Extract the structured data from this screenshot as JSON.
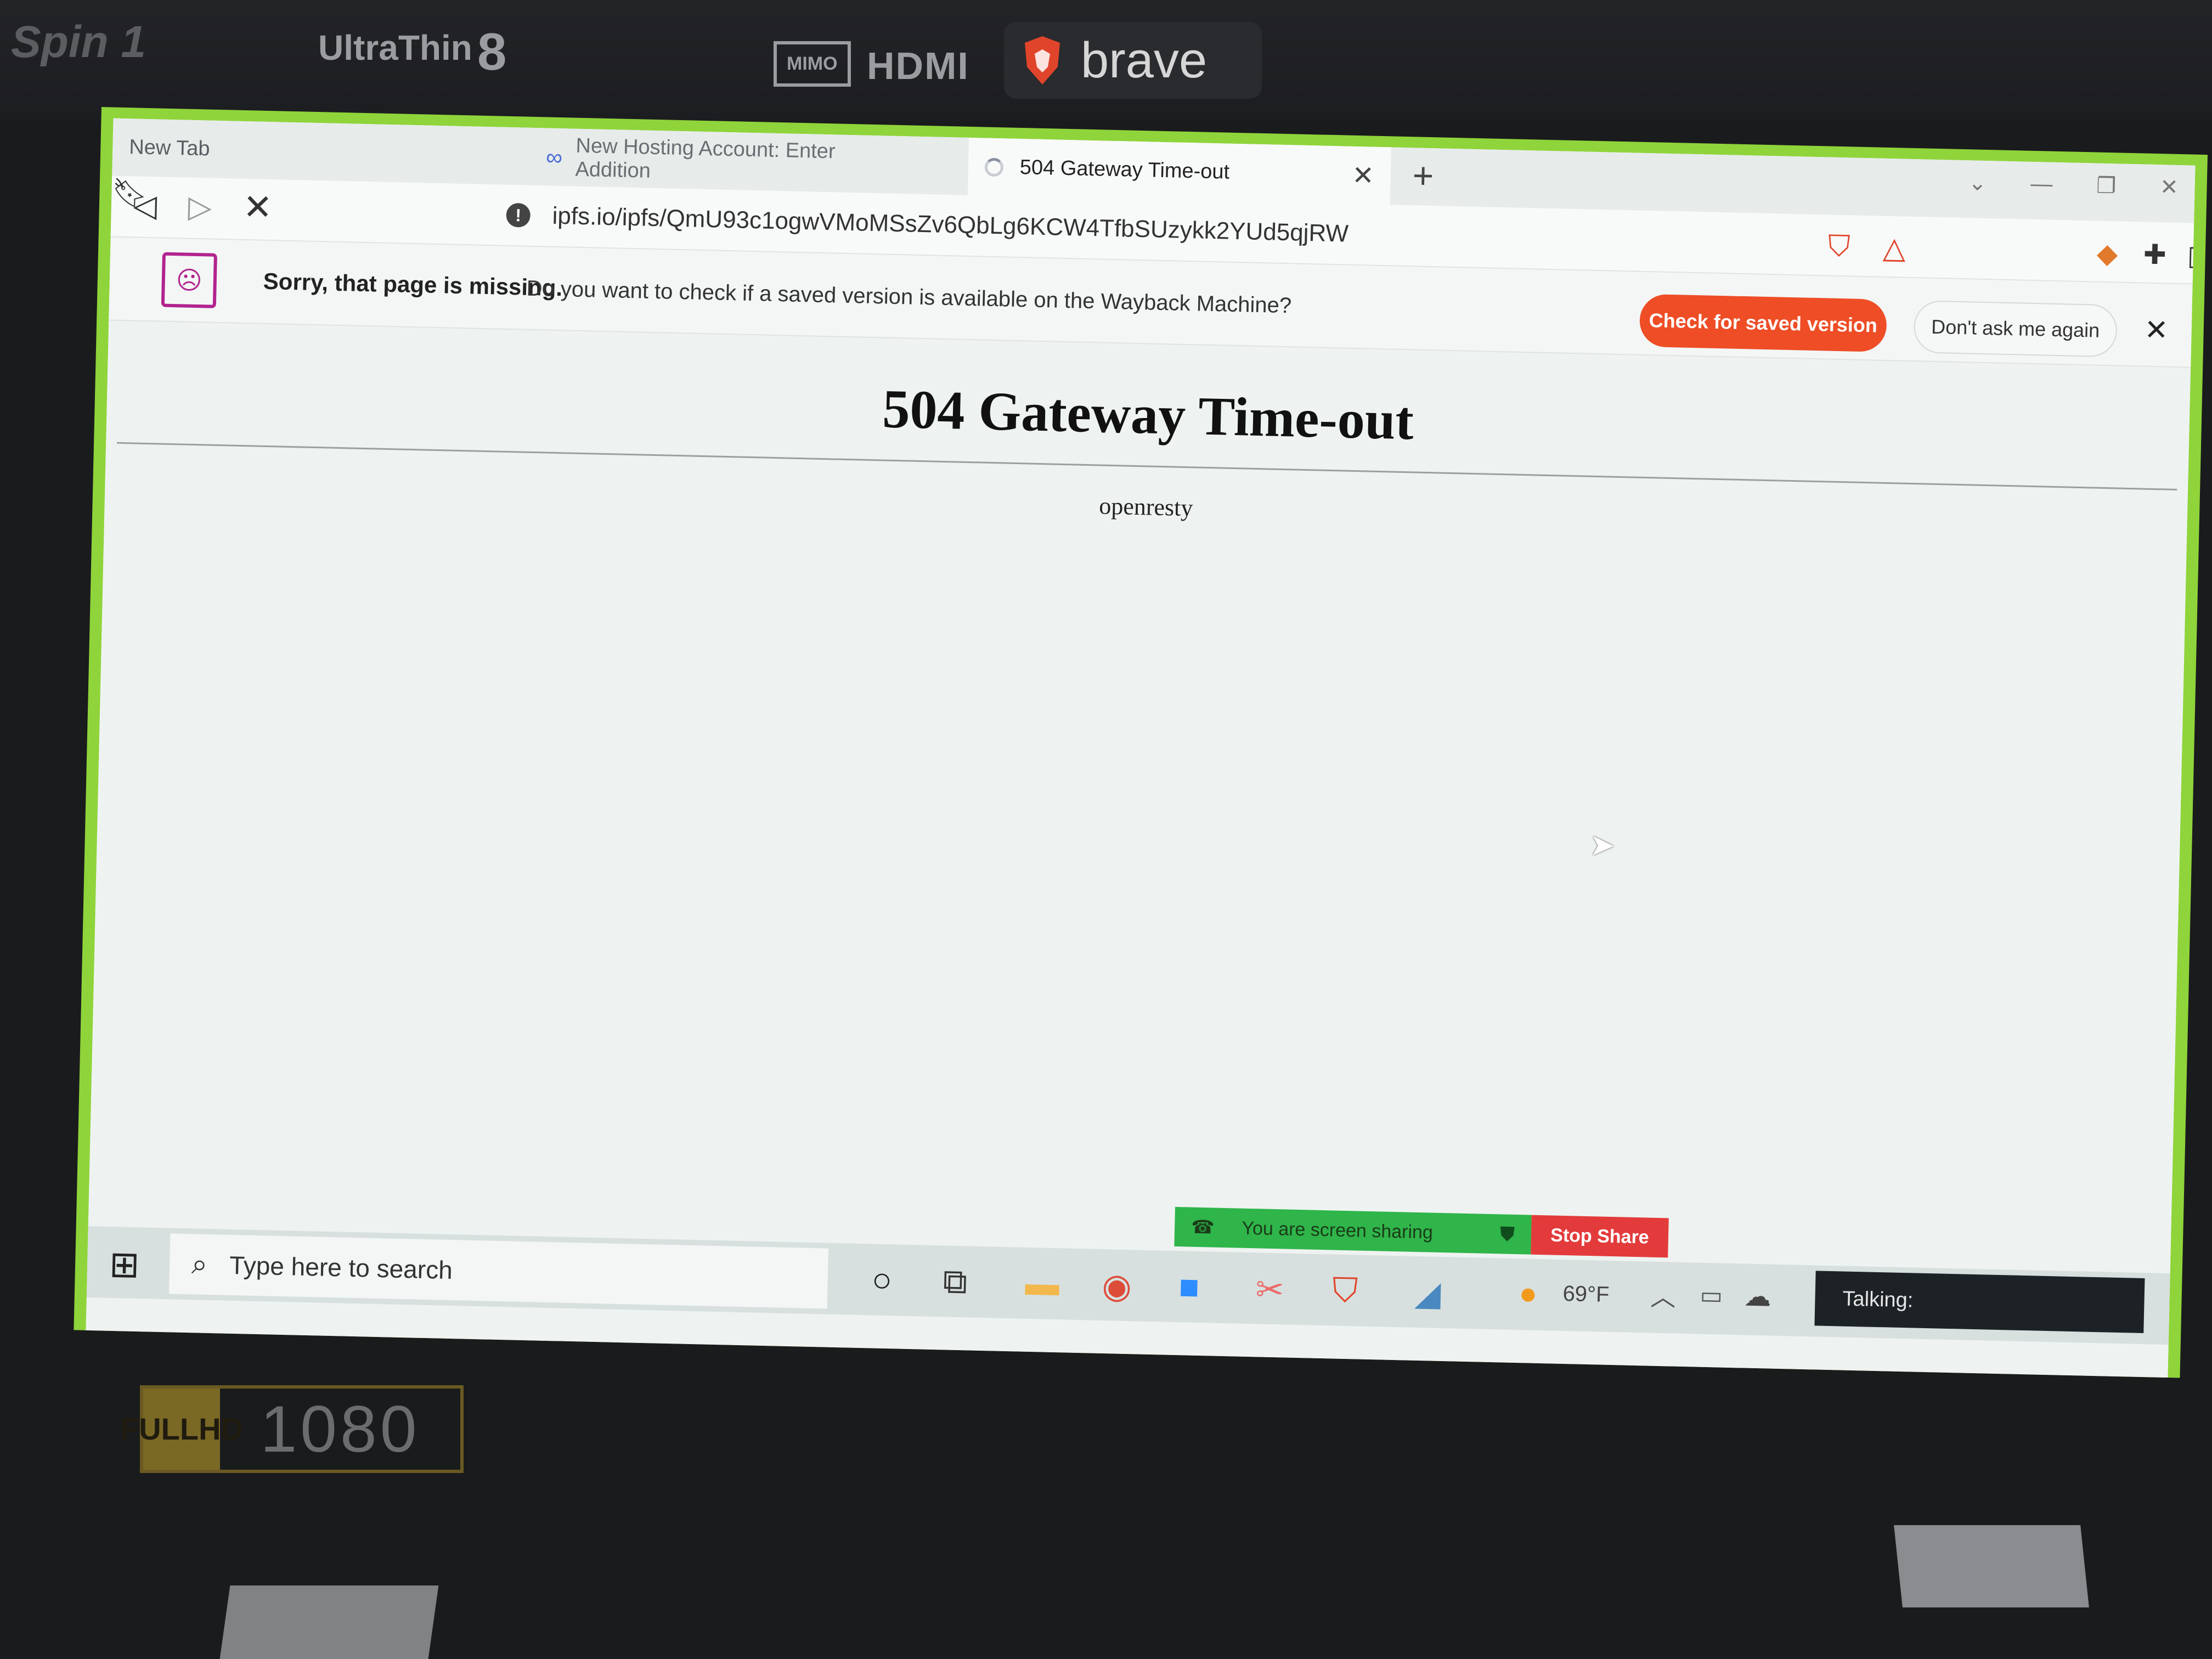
{
  "bezel": {
    "spin_label": "Spin 1",
    "ultrathin_label": "UltraThin",
    "battery_label": "8",
    "mimo_label": "MIMO",
    "hdmi_label": "HDMI",
    "brave_sticker_label": "brave"
  },
  "browser": {
    "tabs": [
      {
        "label": "New Tab"
      },
      {
        "label": "New Hosting Account: Enter Addition"
      },
      {
        "label": "504 Gateway Time-out"
      }
    ],
    "new_tab_symbol": "+",
    "window_controls": [
      "⌄",
      "—",
      "❐",
      "✕"
    ],
    "url": "ipfs.io/ipfs/QmU93c1ogwVMoMSsZv6QbLg6KCW4TfbSUzykk2YUd5qjRW",
    "icons": {
      "back": "back-icon",
      "forward": "forward-icon",
      "stop": "stop-icon",
      "bookmark": "bookmark-icon",
      "site_info": "info-icon",
      "shields": "brave-shields-icon",
      "rewards": "rewards-icon",
      "extensions": [
        "fox-icon",
        "puzzle-icon",
        "wallet-icon",
        "menu-icon"
      ]
    }
  },
  "wayback": {
    "title": "Sorry, that page is missing.",
    "question": "Do you want to check if a saved version is available on the Wayback Machine?",
    "check_button": "Check for saved version",
    "dont_ask_button": "Don't ask me again"
  },
  "page": {
    "heading": "504 Gateway Time-out",
    "server": "openresty"
  },
  "zoom": {
    "sharing_text": "You are screen sharing",
    "stop_share": "Stop Share"
  },
  "taskbar": {
    "search_placeholder": "Type here to search",
    "weather_temp": "69°F",
    "talking_label": "Talking:"
  },
  "laptop": {
    "hd_badge_top": "FULL",
    "hd_badge_bottom": "HD",
    "resolution": "1080"
  },
  "colors": {
    "screen_border": "#8fd43a",
    "brave_orange": "#ee4d26",
    "share_green": "#2fb54a",
    "stop_red": "#e33b3b"
  }
}
